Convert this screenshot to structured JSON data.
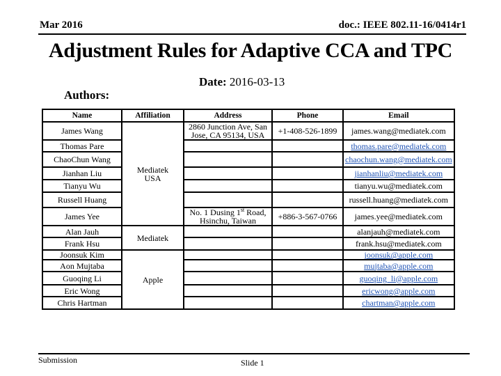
{
  "header": {
    "date_left": "Mar 2016",
    "doc_id": "doc.: IEEE 802.11-16/0414r1"
  },
  "title": "Adjustment Rules for Adaptive CCA and TPC",
  "date": {
    "label": "Date:",
    "value": "2016-03-13"
  },
  "authors_label": "Authors:",
  "table": {
    "columns": [
      "Name",
      "Affiliation",
      "Address",
      "Phone",
      "Email"
    ],
    "affiliations": [
      "Mediatek USA",
      "Mediatek",
      "Apple"
    ],
    "addresses": [
      "2860 Junction Ave, San Jose, CA 95134, USA",
      "No. 1 Dusing 1st Road, Hsinchu, Taiwan"
    ],
    "phones": [
      "+1-408-526-1899",
      "+886-3-567-0766"
    ],
    "rows": [
      {
        "name": "James Wang",
        "email": "james.wang@mediatek.com",
        "link": false
      },
      {
        "name": "Thomas Pare",
        "email": "thomas.pare@mediatek.com",
        "link": true
      },
      {
        "name": "ChaoChun Wang",
        "email": "chaochun.wang@mediatek.com",
        "link": true
      },
      {
        "name": "Jianhan Liu",
        "email": "jianhanliu@mediatek.com",
        "link": true
      },
      {
        "name": "Tianyu Wu",
        "email": "tianyu.wu@mediatek.com",
        "link": false
      },
      {
        "name": "Russell Huang",
        "email": "russell.huang@mediatek.com",
        "link": false
      },
      {
        "name": "James Yee",
        "email": "james.yee@mediatek.com",
        "link": false
      },
      {
        "name": "Alan Jauh",
        "email": "alanjauh@mediatek.com",
        "link": false
      },
      {
        "name": "Frank Hsu",
        "email": "frank.hsu@mediatek.com",
        "link": false
      },
      {
        "name": "Joonsuk Kim",
        "email": "joonsuk@apple.com",
        "link": true
      },
      {
        "name": "Aon Mujtaba",
        "email": "mujtaba@apple.com",
        "link": true
      },
      {
        "name": "Guoqing Li",
        "email": "guoqing_li@apple.com",
        "link": true
      },
      {
        "name": "Eric Wong",
        "email": "ericwong@apple.com",
        "link": true
      },
      {
        "name": "Chris Hartman",
        "email": "chartman@apple.com",
        "link": true
      }
    ]
  },
  "footer": {
    "left": "Submission",
    "center": "Slide 1"
  },
  "colors": {
    "link": "#2255b5",
    "text": "#000000"
  }
}
